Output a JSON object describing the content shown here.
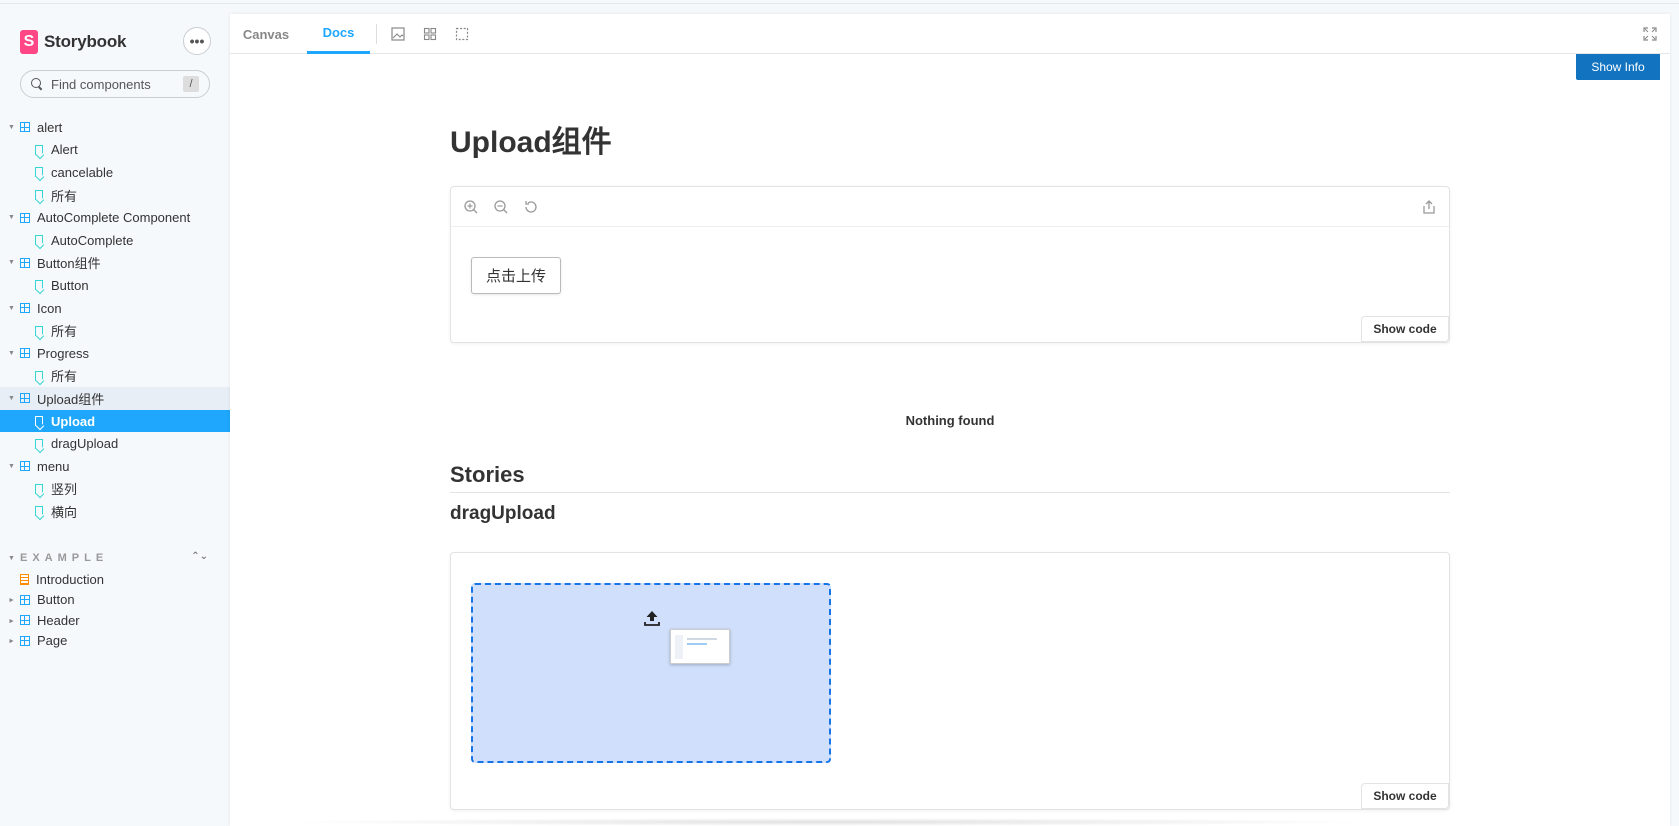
{
  "sidebar": {
    "brand": "Storybook",
    "search_placeholder": "Find components",
    "search_shortcut": "/",
    "tree": [
      {
        "label": "alert",
        "type": "group"
      },
      {
        "label": "Alert",
        "type": "leaf"
      },
      {
        "label": "cancelable",
        "type": "leaf"
      },
      {
        "label": "所有",
        "type": "leaf"
      },
      {
        "label": "AutoComplete Component",
        "type": "group"
      },
      {
        "label": "AutoComplete",
        "type": "leaf"
      },
      {
        "label": "Button组件",
        "type": "group"
      },
      {
        "label": "Button",
        "type": "leaf"
      },
      {
        "label": "Icon",
        "type": "group"
      },
      {
        "label": "所有",
        "type": "leaf"
      },
      {
        "label": "Progress",
        "type": "group"
      },
      {
        "label": "所有",
        "type": "leaf"
      },
      {
        "label": "Upload组件",
        "type": "group"
      },
      {
        "label": "Upload",
        "type": "leaf"
      },
      {
        "label": "dragUpload",
        "type": "leaf"
      },
      {
        "label": "menu",
        "type": "group"
      },
      {
        "label": "竖列",
        "type": "leaf"
      },
      {
        "label": "横向",
        "type": "leaf"
      }
    ],
    "section_title": "EXAMPLE",
    "section_items": [
      {
        "label": "Introduction",
        "type": "doc"
      },
      {
        "label": "Button",
        "type": "component"
      },
      {
        "label": "Header",
        "type": "component"
      },
      {
        "label": "Page",
        "type": "component"
      }
    ]
  },
  "toolbar": {
    "tabs": [
      "Canvas",
      "Docs"
    ],
    "active_tab": "Docs",
    "icons": [
      "image-icon",
      "grid-icon",
      "outline-icon",
      "fullscreen-icon"
    ],
    "show_info": "Show Info"
  },
  "docs": {
    "title": "Upload组件",
    "preview1": {
      "button_label": "点击上传",
      "show_code": "Show code"
    },
    "nothing_found": "Nothing found",
    "stories_heading": "Stories",
    "story_name": "dragUpload",
    "preview2": {
      "show_code": "Show code"
    }
  },
  "colors": {
    "accent": "#1ea7fd",
    "brand": "#ff4785",
    "show_info_bg": "#1274c0",
    "dropzone_bg": "#d0dffb",
    "dropzone_border": "#1774e6"
  }
}
